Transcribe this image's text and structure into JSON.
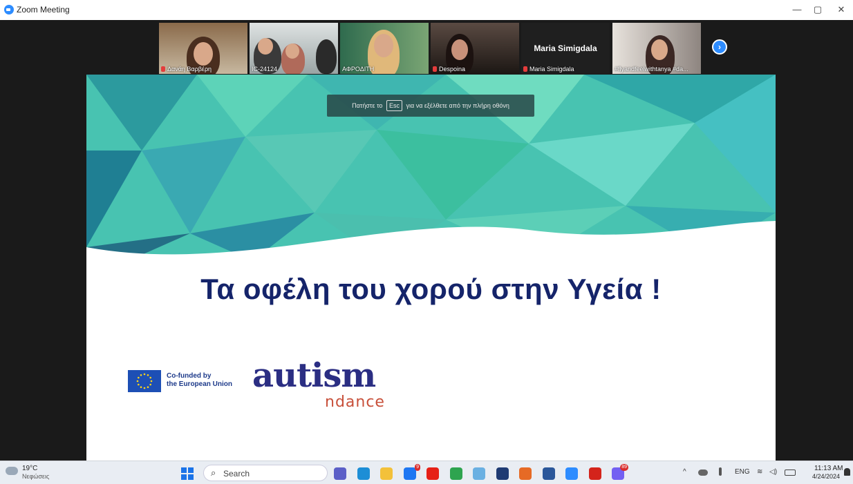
{
  "window": {
    "title": "Zoom Meeting",
    "controls": {
      "minimize": "—",
      "restore": "▢",
      "close": "✕"
    }
  },
  "participants": [
    {
      "name": "Δανάη Βαρβέρη",
      "muted": true
    },
    {
      "name": "IC-24124",
      "muted": false
    },
    {
      "name": "ΑΦΡΟΔΙΤΗ",
      "muted": false
    },
    {
      "name": "Despoina",
      "muted": true
    },
    {
      "name": "Maria Simigdala",
      "display_name": "Maria Simigdala",
      "muted": true
    },
    {
      "name": "#flyandfeelwithtanya #da...",
      "muted": false
    }
  ],
  "next_icon": "chevron-right-icon",
  "fullscreen_toast": {
    "before": "Πατήστε το",
    "key": "Esc",
    "after": "για να εξέλθετε από την πλήρη οθόνη"
  },
  "slide": {
    "title": "Τα οφέλη του χορού στην Υγεία !",
    "eu_text_line1": "Co-funded by",
    "eu_text_line2": "the European Union",
    "logo_main": "autism",
    "logo_sub": "ndance",
    "colors": {
      "title": "#15246a",
      "logo": "#2b2e83",
      "teal": "#3fb6b0"
    }
  },
  "taskbar": {
    "weather": {
      "temp": "19°C",
      "desc": "Νεφώσεις"
    },
    "search_label": "Search",
    "apps": [
      {
        "icon": "teams-icon",
        "color": "#5b5fc7"
      },
      {
        "icon": "edge-icon",
        "color": "#1d8ed6"
      },
      {
        "icon": "file-explorer-icon",
        "color": "#f3c13a"
      },
      {
        "icon": "messenger-icon",
        "color": "#1e77f2",
        "badge": "9"
      },
      {
        "icon": "youtube-icon",
        "color": "#e62117"
      },
      {
        "icon": "chrome-icon",
        "color": "#2ea44f"
      },
      {
        "icon": "snipping-tool-icon",
        "color": "#6ab0e2"
      },
      {
        "icon": "security-icon",
        "color": "#1f3b73"
      },
      {
        "icon": "firefox-icon",
        "color": "#e66a25"
      },
      {
        "icon": "word-icon",
        "color": "#2b579a"
      },
      {
        "icon": "zoom-icon",
        "color": "#2d8cff"
      },
      {
        "icon": "acrobat-icon",
        "color": "#d4241b"
      },
      {
        "icon": "viber-icon",
        "color": "#7360f2",
        "badge": "89"
      }
    ],
    "tray": {
      "chevron": "^",
      "language": "ENG"
    },
    "clock": {
      "time": "11:13 AM",
      "date": "4/24/2024"
    }
  }
}
